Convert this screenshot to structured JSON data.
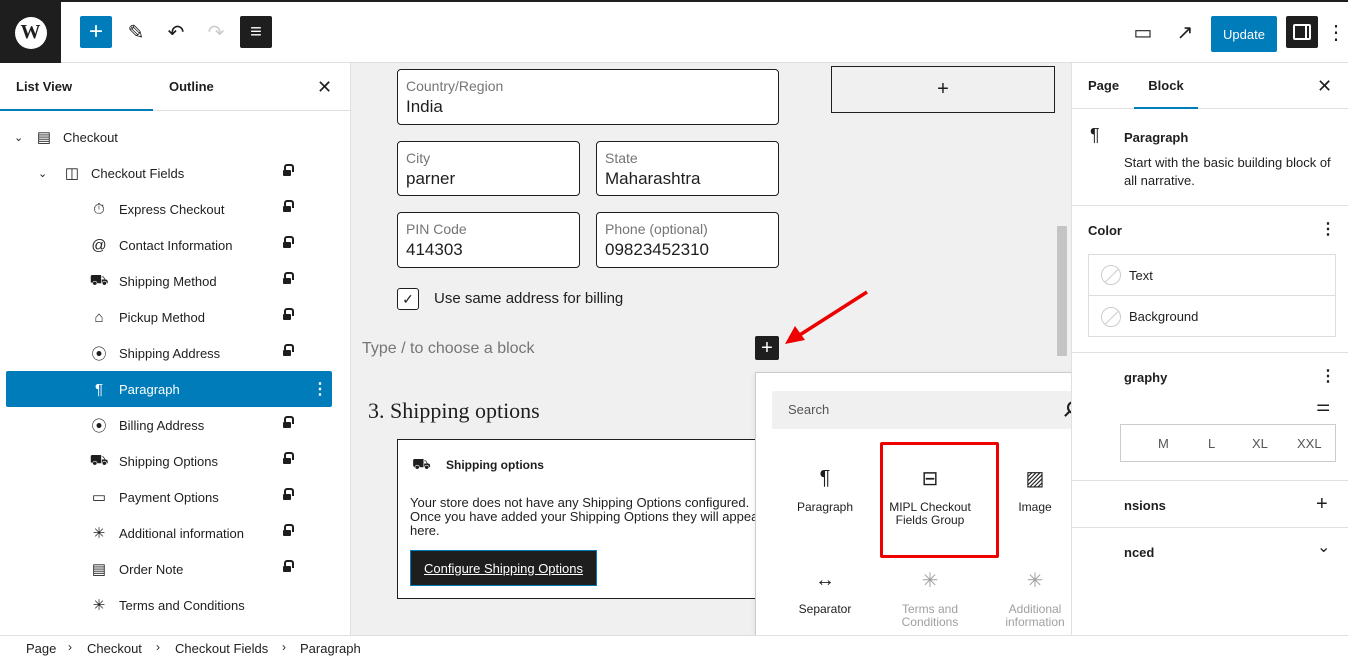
{
  "toolbar": {
    "logo": "W",
    "add_icon": "+",
    "edit_icon": "✎",
    "undo_icon": "↶",
    "redo_icon": "↷",
    "document_overview_icon": "≡",
    "view_icon": "▭",
    "external_icon": "↗",
    "update_label": "Update",
    "options_icon": "⋮",
    "accent_color": "#007cba"
  },
  "left_panel": {
    "tabs": [
      "List View",
      "Outline"
    ],
    "close_icon": "✕",
    "items": [
      {
        "label": "Checkout",
        "icon": "▤",
        "locked": false
      },
      {
        "label": "Checkout Fields",
        "icon": "◫",
        "locked": true
      },
      {
        "label": "Express Checkout",
        "icon": "⏱",
        "locked": true
      },
      {
        "label": "Contact Information",
        "icon": "@",
        "locked": true
      },
      {
        "label": "Shipping Method",
        "icon": "⛟",
        "locked": true
      },
      {
        "label": "Pickup Method",
        "icon": "⌂",
        "locked": true
      },
      {
        "label": "Shipping Address",
        "icon": "⦿",
        "locked": true
      },
      {
        "label": "Paragraph",
        "icon": "¶",
        "selected": true
      },
      {
        "label": "Billing Address",
        "icon": "⦿",
        "locked": true
      },
      {
        "label": "Shipping Options",
        "icon": "⛟",
        "locked": true
      },
      {
        "label": "Payment Options",
        "icon": "▭",
        "locked": true
      },
      {
        "label": "Additional information",
        "icon": "✳",
        "locked": true
      },
      {
        "label": "Order Note",
        "icon": "▤",
        "locked": true
      },
      {
        "label": "Terms and Conditions",
        "icon": "✳",
        "locked": false
      }
    ]
  },
  "canvas": {
    "country_label": "Country/Region",
    "country_value": "India",
    "city_label": "City",
    "city_value": "parner",
    "state_label": "State",
    "state_value": "Maharashtra",
    "pin_label": "PIN Code",
    "pin_value": "414303",
    "phone_label": "Phone (optional)",
    "phone_value": "09823452310",
    "same_billing_label": "Use same address for billing",
    "checkmark": "✓",
    "block_placeholder": "Type / to choose a block",
    "add_block_icon": "+",
    "side_add_icon": "+",
    "shipping_heading": "3.  Shipping options",
    "shipping_box_title": "Shipping options",
    "shipping_box_text": "Your store does not have any Shipping Options configured. Once you have added your Shipping Options they will appear here.",
    "configure_button": "Configure Shipping Options"
  },
  "inserter": {
    "search_placeholder": "Search",
    "blocks": [
      {
        "label": "Paragraph",
        "icon": "¶",
        "disabled": false
      },
      {
        "label": "MIPL Checkout Fields Group",
        "icon": "⊟",
        "disabled": false,
        "highlighted": true
      },
      {
        "label": "Image",
        "icon": "▨",
        "disabled": false
      },
      {
        "label": "Separator",
        "icon": "↔",
        "disabled": false
      },
      {
        "label": "Terms and Conditions",
        "icon": "✳",
        "disabled": true
      },
      {
        "label": "Additional information",
        "icon": "✳",
        "disabled": true
      }
    ],
    "highlight_color": "#e00000"
  },
  "right_panel": {
    "tabs": [
      "Page",
      "Block"
    ],
    "close_icon": "✕",
    "block_icon": "¶",
    "block_name": "Paragraph",
    "block_description": "Start with the basic building block of all narrative.",
    "color_title": "Color",
    "color_items": [
      "Text",
      "Background"
    ],
    "typography_title": "graphy",
    "sizes": [
      "M",
      "L",
      "XL",
      "XXL"
    ],
    "dimensions_title": "nsions",
    "advanced_title": "nced",
    "options_icon": "⋮",
    "plus_icon": "+",
    "chevron_icon": "⌄",
    "filter_icon": "⚌"
  },
  "breadcrumb": [
    "Page",
    "Checkout",
    "Checkout Fields",
    "Paragraph"
  ],
  "breadcrumb_sep": "›"
}
